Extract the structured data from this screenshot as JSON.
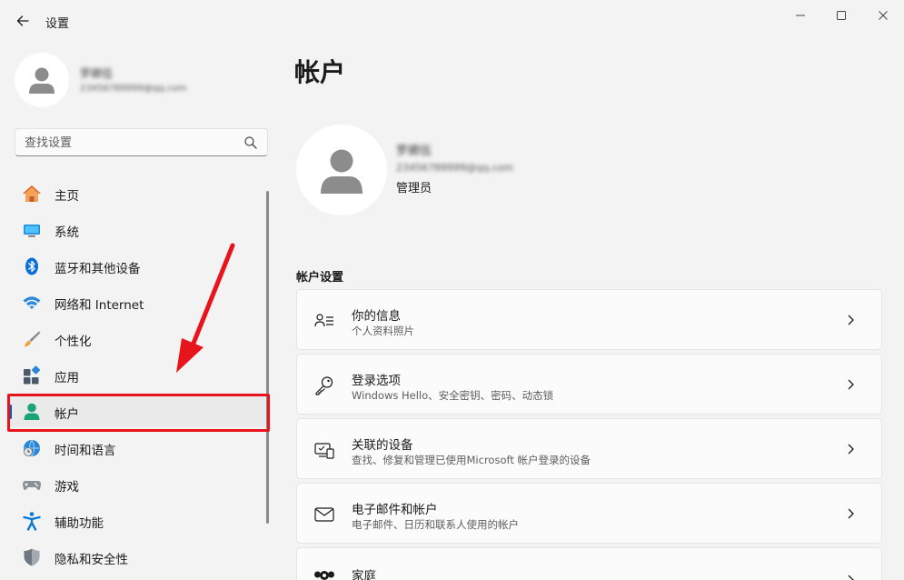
{
  "window": {
    "title": "设置"
  },
  "profile": {
    "name": "罗卿伍",
    "email": "23456789999@qq.com",
    "role": "管理员"
  },
  "search": {
    "placeholder": "查找设置"
  },
  "sidebar": {
    "items": [
      {
        "label": "主页",
        "icon": "home-icon"
      },
      {
        "label": "系统",
        "icon": "display-icon"
      },
      {
        "label": "蓝牙和其他设备",
        "icon": "bluetooth-icon"
      },
      {
        "label": "网络和 Internet",
        "icon": "wifi-icon"
      },
      {
        "label": "个性化",
        "icon": "brush-icon"
      },
      {
        "label": "应用",
        "icon": "apps-icon"
      },
      {
        "label": "帐户",
        "icon": "person-icon",
        "active": true
      },
      {
        "label": "时间和语言",
        "icon": "globe-clock-icon"
      },
      {
        "label": "游戏",
        "icon": "gamepad-icon"
      },
      {
        "label": "辅助功能",
        "icon": "accessibility-icon"
      },
      {
        "label": "隐私和安全性",
        "icon": "shield-icon"
      }
    ]
  },
  "main": {
    "title": "帐户",
    "section_title": "帐户设置",
    "cards": [
      {
        "title": "你的信息",
        "desc": "个人资料照片",
        "icon": "person-info-icon"
      },
      {
        "title": "登录选项",
        "desc": "Windows Hello、安全密钥、密码、动态锁",
        "icon": "key-icon"
      },
      {
        "title": "关联的设备",
        "desc": "查找、修复和管理已使用Microsoft 帐户登录的设备",
        "icon": "linked-devices-icon"
      },
      {
        "title": "电子邮件和帐户",
        "desc": "电子邮件、日历和联系人使用的帐户",
        "icon": "mail-icon"
      },
      {
        "title": "家庭",
        "desc": "",
        "icon": "family-icon"
      }
    ]
  },
  "colors": {
    "accent": "#005fb8",
    "annotation_red": "#e8141b"
  }
}
